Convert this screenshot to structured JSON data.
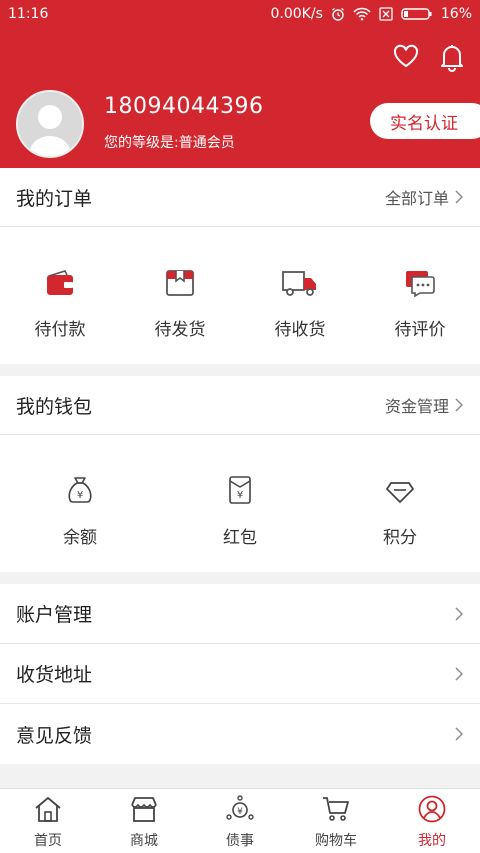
{
  "status_bar": {
    "time": "11:16",
    "net_speed": "0.00K/s",
    "battery": "16%"
  },
  "profile": {
    "phone": "18094044396",
    "level_text": "您的等级是:普通会员",
    "verify_button": "实名认证"
  },
  "orders": {
    "title": "我的订单",
    "link": "全部订单",
    "items": [
      {
        "label": "待付款",
        "icon": "wallet-icon"
      },
      {
        "label": "待发货",
        "icon": "package-icon"
      },
      {
        "label": "待收货",
        "icon": "truck-icon"
      },
      {
        "label": "待评价",
        "icon": "comment-icon"
      }
    ]
  },
  "wallet": {
    "title": "我的钱包",
    "link": "资金管理",
    "items": [
      {
        "label": "余额",
        "icon": "money-bag-icon"
      },
      {
        "label": "红包",
        "icon": "red-packet-icon"
      },
      {
        "label": "积分",
        "icon": "diamond-icon"
      }
    ]
  },
  "menu": [
    {
      "label": "账户管理"
    },
    {
      "label": "收货地址"
    },
    {
      "label": "意见反馈"
    }
  ],
  "tabbar": [
    {
      "label": "首页",
      "icon": "home-icon"
    },
    {
      "label": "商城",
      "icon": "store-icon"
    },
    {
      "label": "债事",
      "icon": "debt-icon"
    },
    {
      "label": "购物车",
      "icon": "cart-icon"
    },
    {
      "label": "我的",
      "icon": "user-icon",
      "active": true
    }
  ],
  "colors": {
    "accent": "#d3272f",
    "background": "#f2f2f2"
  }
}
